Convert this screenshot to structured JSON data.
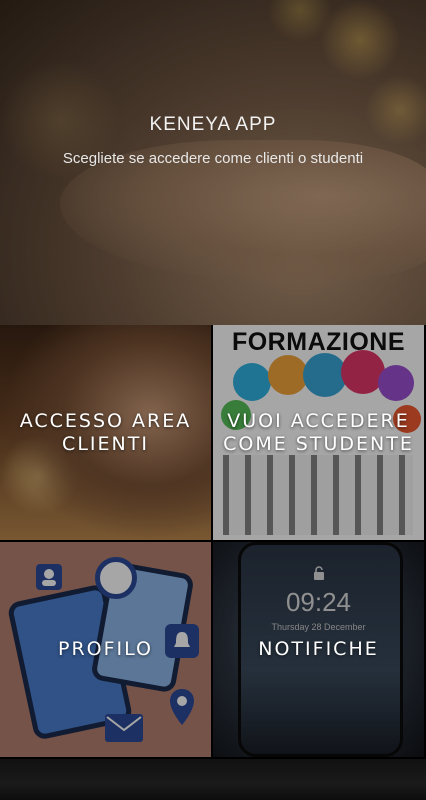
{
  "header": {
    "title": "KENEYA APP",
    "subtitle": "Scegliete se accedere come clienti o studenti"
  },
  "tiles": [
    {
      "id": "clienti",
      "label": "ACCESSO AREA CLIENTI",
      "lines": [
        "ACCESSO AREA",
        "CLIENTI"
      ]
    },
    {
      "id": "studente",
      "label": "VUOI ACCEDERE COME STUDENTE",
      "lines": [
        "VUOI ACCEDERE",
        "COME STUDENTE"
      ],
      "image_text": "FORMAZIONE"
    },
    {
      "id": "profilo",
      "label": "PROFILO",
      "lines": [
        "PROFILO"
      ]
    },
    {
      "id": "notifiche",
      "label": "NOTIFICHE",
      "lines": [
        "NOTIFICHE"
      ],
      "image_text": [
        "09:24",
        "Thursday 28 December"
      ]
    }
  ],
  "icons": [
    "clock-icon",
    "bell-icon",
    "location-pin-icon",
    "mail-icon",
    "user-icon",
    "lock-icon"
  ]
}
